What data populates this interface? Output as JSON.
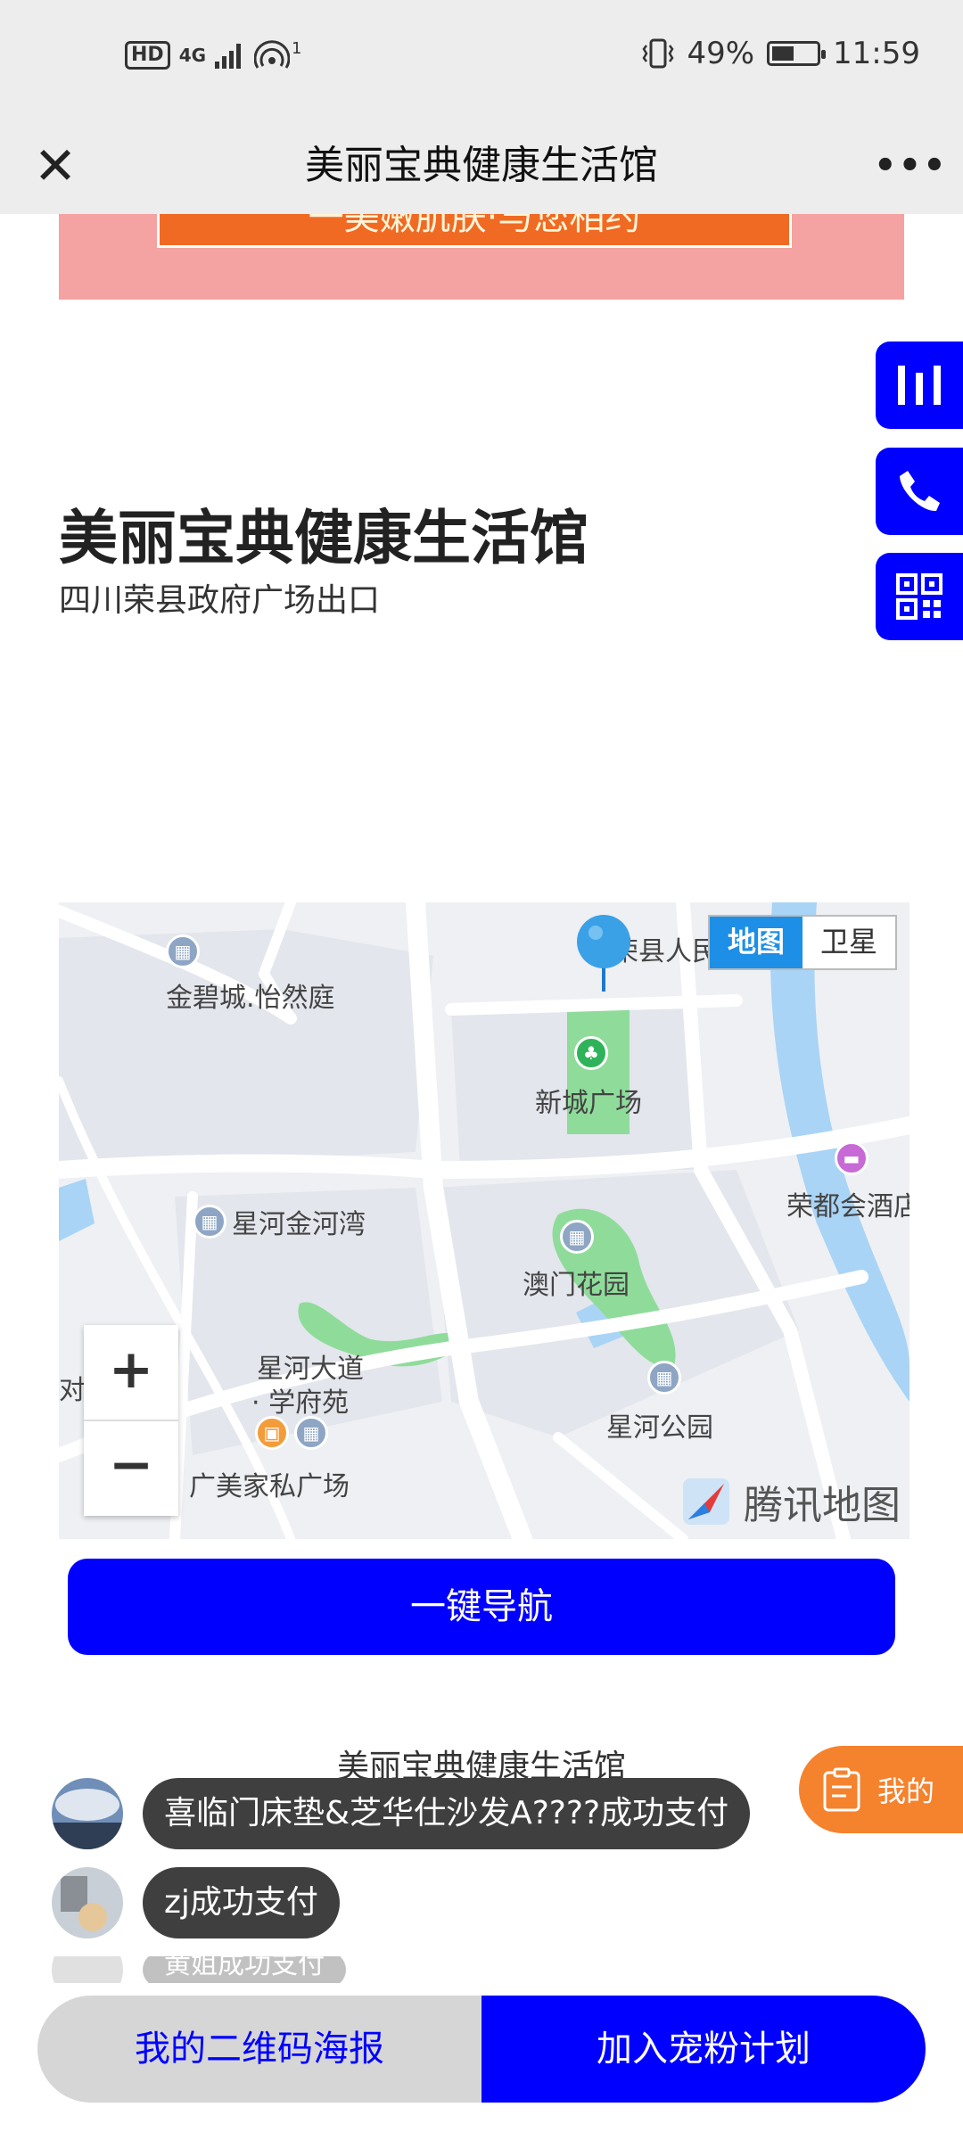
{
  "status_bar": {
    "hd": "HD",
    "network": "4G",
    "wifi_sup": "1",
    "battery_pct": "49%",
    "battery_level": 0.49,
    "time": "11:59"
  },
  "title_bar": {
    "title": "美丽宝典健康生活馆",
    "close_icon": "close-icon",
    "more_icon": "more-icon"
  },
  "banner": {
    "text": "一美嫩肌肤·与您相约"
  },
  "side_buttons": [
    {
      "name": "stats-icon"
    },
    {
      "name": "phone-icon"
    },
    {
      "name": "qr-code-icon"
    }
  ],
  "shop": {
    "name": "美丽宝典健康生活馆",
    "address": "四川荣县政府广场出口"
  },
  "map": {
    "labels": {
      "jinbicheng": "金碧城.怡然庭",
      "xinchengguangchang": "新城广场",
      "xinghejinhewan": "星河金河湾",
      "aomenhuayuan": "澳门花园",
      "rongduhuijiudian": "荣都会酒店",
      "xinghedadao_line1": "星河大道",
      "xinghedadao_line2": "· 学府苑",
      "xinghegongyuan": "星河公园",
      "guangmeijiasi": "广美家私广场",
      "rongxianren": "荣县人民",
      "dui": "对"
    },
    "toggle": {
      "map": "地图",
      "satellite": "卫星"
    },
    "zoom_in": "+",
    "zoom_out": "−",
    "provider": "腾讯地图",
    "colors": {
      "road": "#ffffff",
      "green": "#8fdc9a",
      "water": "#a9d4f5",
      "block": "#e3e6ec"
    }
  },
  "navigate_button": "一键导航",
  "footer_shop_name": "美丽宝典健康生活馆",
  "my_button": "我的",
  "toasts": [
    {
      "text": "喜临门床垫&芝华仕沙发A????成功支付"
    },
    {
      "text": "zj成功支付"
    },
    {
      "text": "黄姐成功支付"
    }
  ],
  "bottom_bar": {
    "poster": "我的二维码海报",
    "join": "加入宠粉计划"
  },
  "colors": {
    "accent_blue": "#0000ff",
    "orange": "#f5822d",
    "banner_pink": "#f4a2a2"
  }
}
